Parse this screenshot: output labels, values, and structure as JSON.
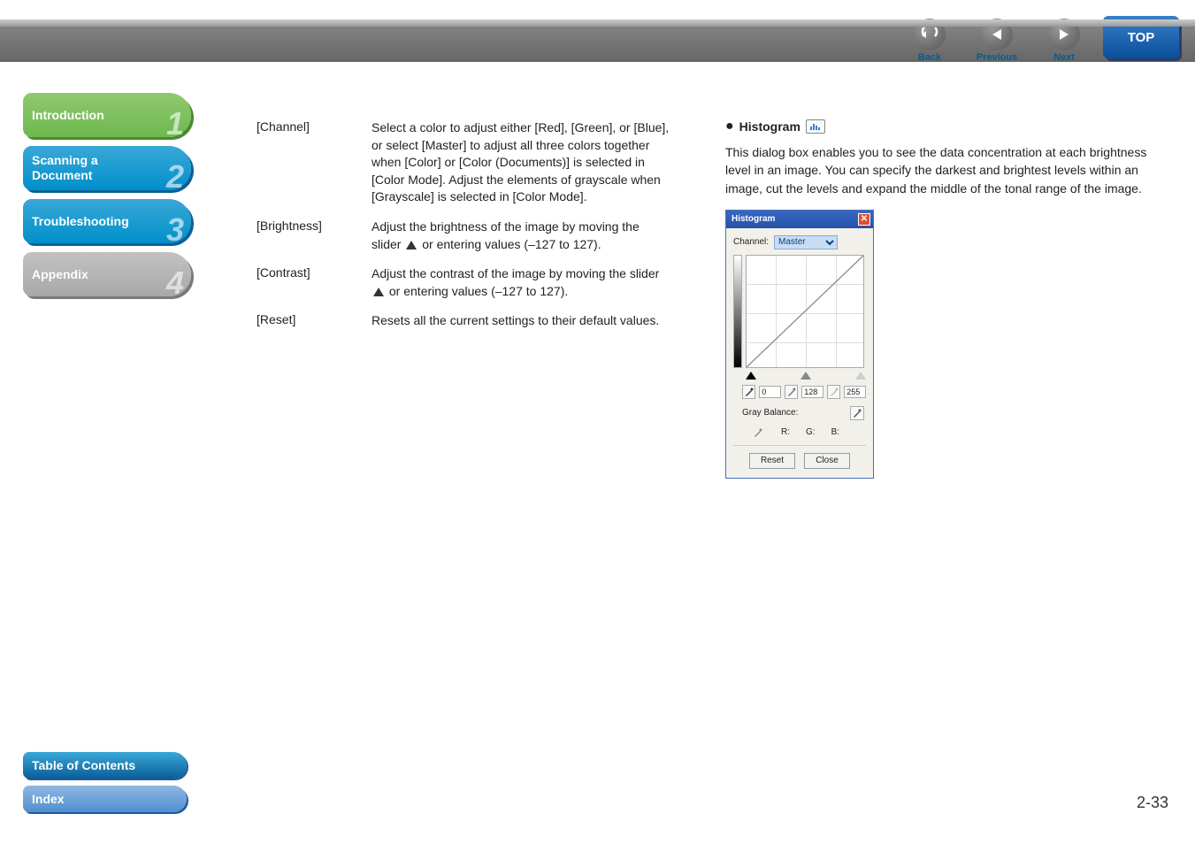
{
  "topnav": {
    "back": {
      "label": "Back"
    },
    "prev": {
      "label": "Previous"
    },
    "next": {
      "label": "Next"
    },
    "top": {
      "label": "TOP"
    }
  },
  "sidebar": {
    "items": [
      {
        "label": "Introduction",
        "num": "1",
        "variant": "green"
      },
      {
        "label": "Scanning a\nDocument",
        "num": "2",
        "variant": "cyan"
      },
      {
        "label": "Troubleshooting",
        "num": "3",
        "variant": "cyan2"
      },
      {
        "label": "Appendix",
        "num": "4",
        "variant": "gray"
      }
    ],
    "toc_label": "Table of Contents",
    "index_label": "Index"
  },
  "settings": [
    {
      "label": "[Channel]",
      "desc": "Select a color to adjust either [Red], [Green], or [Blue], or select [Master] to adjust all three colors together when [Color] or [Color (Documents)] is selected in [Color Mode]. Adjust the elements of grayscale when [Grayscale] is selected in [Color Mode]."
    },
    {
      "label": "[Brightness]",
      "desc_pre": "Adjust the brightness of the image by moving the slider ",
      "desc_post": " or entering values (–127 to 127)."
    },
    {
      "label": "[Contrast]",
      "desc_pre": "Adjust the contrast of the image by moving the slider ",
      "desc_post": " or entering values (–127 to 127)."
    },
    {
      "label": "[Reset]",
      "desc": "Resets all the current settings to their default values."
    }
  ],
  "histogram": {
    "heading": "Histogram",
    "para": "This dialog box enables you to see the data concentration at each brightness level in an image. You can specify the darkest and brightest levels within an image, cut the levels and expand the middle of the tonal range of the image.",
    "dialog": {
      "title": "Histogram",
      "channel_label": "Channel:",
      "channel_value": "Master",
      "black_val": "0",
      "mid_val": "128",
      "white_val": "255",
      "gray_balance_label": "Gray Balance:",
      "r_label": "R:",
      "g_label": "G:",
      "b_label": "B:",
      "reset_label": "Reset",
      "close_label": "Close"
    }
  },
  "page_number": "2-33"
}
